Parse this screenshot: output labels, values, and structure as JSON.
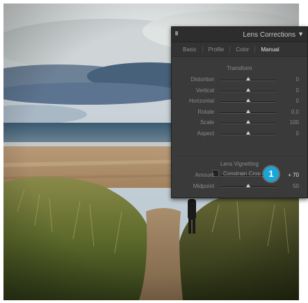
{
  "panel": {
    "title": "Lens Corrections",
    "collapse_icon": "triangle-down-icon",
    "tabs": [
      {
        "label": "Basic"
      },
      {
        "label": "Profile"
      },
      {
        "label": "Color"
      },
      {
        "label": "Manual",
        "active": true
      }
    ],
    "transform": {
      "title": "Transform",
      "sliders": [
        {
          "label": "Distortion",
          "value": "0",
          "position": 0.5
        },
        {
          "label": "Vertical",
          "value": "0",
          "position": 0.5
        },
        {
          "label": "Horizontal",
          "value": "0",
          "position": 0.5
        },
        {
          "label": "Rotate",
          "value": "0.0",
          "position": 0.5
        },
        {
          "label": "Scale",
          "value": "100",
          "position": 0.5
        },
        {
          "label": "Aspect",
          "value": "0",
          "position": 0.5
        }
      ],
      "constrain_crop": {
        "label": "Constrain Crop",
        "checked": false
      }
    },
    "vignetting": {
      "title": "Lens Vignetting",
      "sliders": [
        {
          "label": "Amount",
          "value": "+ 70",
          "position": 0.85
        },
        {
          "label": "Midpoint",
          "value": "50",
          "position": 0.5
        }
      ]
    }
  },
  "callout": {
    "number": "1",
    "color": "#1aa6d8"
  }
}
